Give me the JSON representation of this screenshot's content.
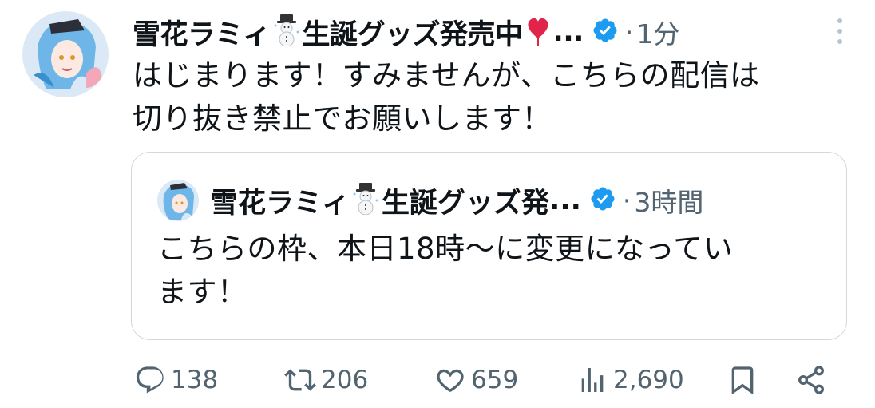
{
  "tweet": {
    "author_name": "雪花ラミィ",
    "author_name_suffix": "生誕グッズ発売中",
    "ellipsis": "...",
    "time_prefix": "·",
    "time": "1分",
    "text_line1": "はじまります！すみませんが、こちらの配信は",
    "text_line2": "切り抜き禁止でお願いします！"
  },
  "quoted": {
    "author_name": "雪花ラミィ",
    "author_name_suffix": "生誕グッズ発",
    "ellipsis": "...",
    "time_prefix": "·",
    "time": "3時間",
    "text_line1": "こちらの枠、本日18時〜に変更になってい",
    "text_line2": "ます！"
  },
  "actions": {
    "replies": "138",
    "retweets": "206",
    "likes": "659",
    "views": "2,690"
  },
  "colors": {
    "verified": "#1d9bf0",
    "muted": "#536471",
    "border": "#cfd9de",
    "heart_emoji": "#e0244a"
  },
  "icons": [
    "snowman-emoji",
    "heart-emoji",
    "verified-badge-icon",
    "more-dots-icon",
    "reply-icon",
    "retweet-icon",
    "like-icon",
    "views-icon",
    "bookmark-icon",
    "share-icon"
  ]
}
